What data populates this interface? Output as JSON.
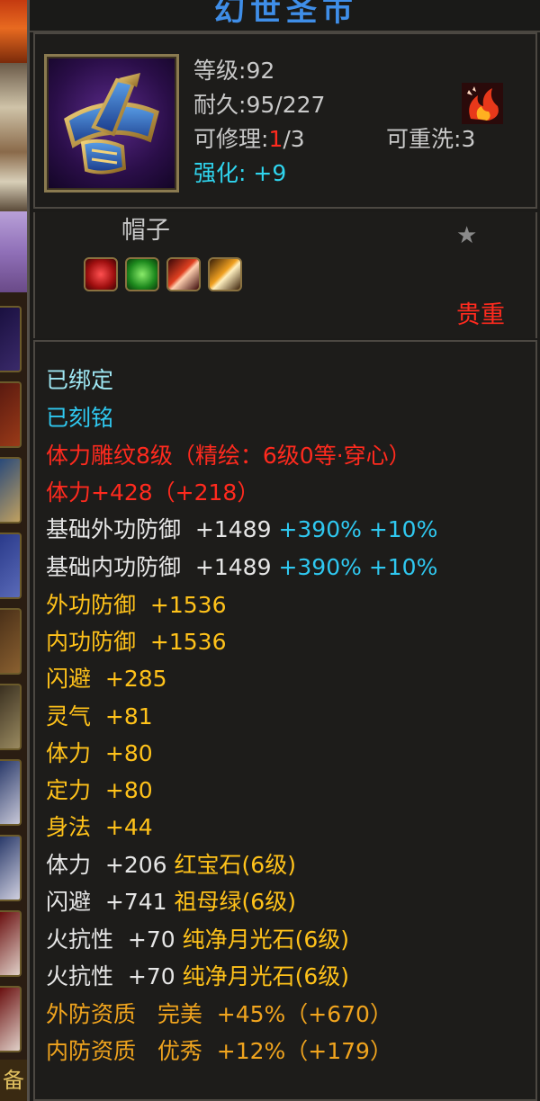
{
  "left_strip": {
    "bottom_char": "备"
  },
  "title": "幻世圣市",
  "item": {
    "level_label": "等级",
    "level_sep": ":",
    "level_value": "92",
    "durability_label": "耐久",
    "durability_sep": ":",
    "durability_value": "95/227",
    "repair_label": "可修理",
    "repair_sep": ":",
    "repair_current": "1",
    "repair_max": "/3",
    "rewash_label": "可重洗",
    "rewash_sep": ":",
    "rewash_value": "3",
    "enhance_label": "强化",
    "enhance_sep": ": ",
    "enhance_value": "+9",
    "name": "帽子",
    "quality": "贵重",
    "icon": "hat-icon",
    "skill_icon": "flame-skill-icon",
    "star_icon": "star-icon",
    "gem_icons": [
      "red-gem-socket-icon",
      "green-gem-socket-icon",
      "red-crystal-socket-icon",
      "moonstone-socket-icon"
    ]
  },
  "stats": {
    "bound": "已绑定",
    "engraved": "已刻铭",
    "carving": "体力雕纹8级（精绘：6级0等·穿心）",
    "stamina_line": "体力+428（+218）",
    "base_ext_def_label": "基础外功防御",
    "base_ext_def_value": "+1489",
    "base_ext_def_bonus": "+390% +10%",
    "base_int_def_label": "基础内功防御",
    "base_int_def_value": "+1489",
    "base_int_def_bonus": "+390% +10%",
    "yellow_lines": [
      {
        "label": "外功防御",
        "value": "+1536"
      },
      {
        "label": "内功防御",
        "value": "+1536"
      },
      {
        "label": "闪避",
        "value": "+285"
      },
      {
        "label": "灵气",
        "value": "+81"
      },
      {
        "label": "体力",
        "value": "+80"
      },
      {
        "label": "定力",
        "value": "+80"
      },
      {
        "label": "身法",
        "value": "+44"
      }
    ],
    "gem_lines": [
      {
        "label": "体力",
        "value": "+206",
        "gem": "红宝石(6级)"
      },
      {
        "label": "闪避",
        "value": "+741",
        "gem": "祖母绿(6级)"
      },
      {
        "label": "火抗性",
        "value": "+70",
        "gem": "纯净月光石(6级)"
      },
      {
        "label": "火抗性",
        "value": "+70",
        "gem": "纯净月光石(6级)"
      }
    ],
    "quality_lines": [
      {
        "label": "外防资质",
        "grade": "完美",
        "value": "+45%（+670）"
      },
      {
        "label": "内防资质",
        "grade": "优秀",
        "value": "+12%（+179）"
      }
    ]
  },
  "colors": {
    "title": "#3f8ee8",
    "red": "#ff2a1e",
    "cyan": "#2fd4ee",
    "yellow": "#ffc21a",
    "orange": "#f0a41e",
    "frame": "#4c4842"
  }
}
